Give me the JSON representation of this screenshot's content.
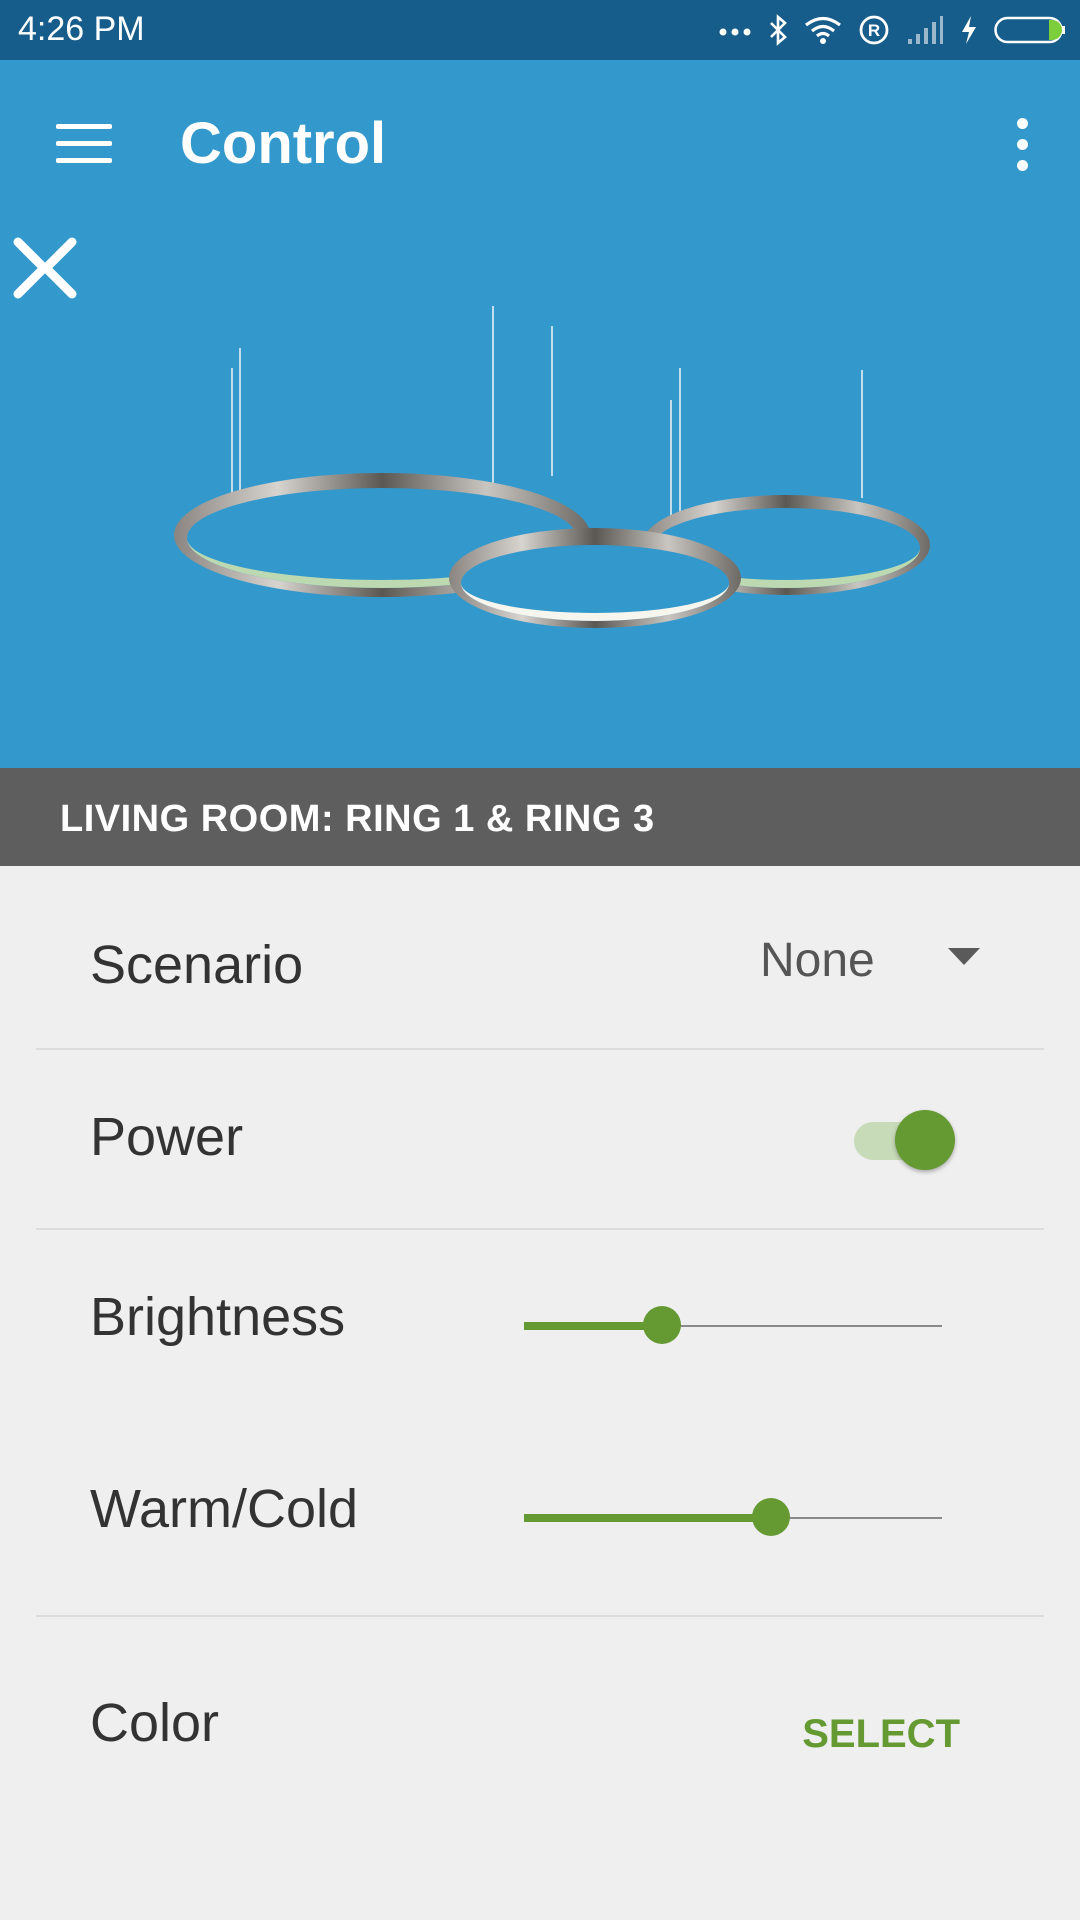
{
  "status_bar": {
    "time": "4:26 PM",
    "icons": [
      "more-dots-icon",
      "bluetooth-icon",
      "wifi-icon",
      "registered-icon",
      "signal-icon",
      "charging-icon",
      "battery-icon"
    ]
  },
  "app_bar": {
    "title": "Control",
    "menu_icon": "hamburger-menu-icon",
    "overflow_icon": "overflow-menu-icon"
  },
  "device_selector": {
    "prev_icon": "chevron-left-icon",
    "next_icon": "chevron-right-icon",
    "device_label": "LIVING ROOM: RING 1 & RING 3"
  },
  "controls": {
    "scenario": {
      "label": "Scenario",
      "value": "None"
    },
    "power": {
      "label": "Power",
      "on": true
    },
    "brightness": {
      "label": "Brightness",
      "level": 0.33
    },
    "warm_cold": {
      "label": "Warm/Cold",
      "level": 0.59
    },
    "color": {
      "label": "Color",
      "action": "SELECT"
    }
  },
  "colors": {
    "status_bar": "#175d8c",
    "app_bar": "#3399cc",
    "room_bar": "#5e5e5e",
    "accent": "#659a33",
    "background": "#efefef"
  }
}
